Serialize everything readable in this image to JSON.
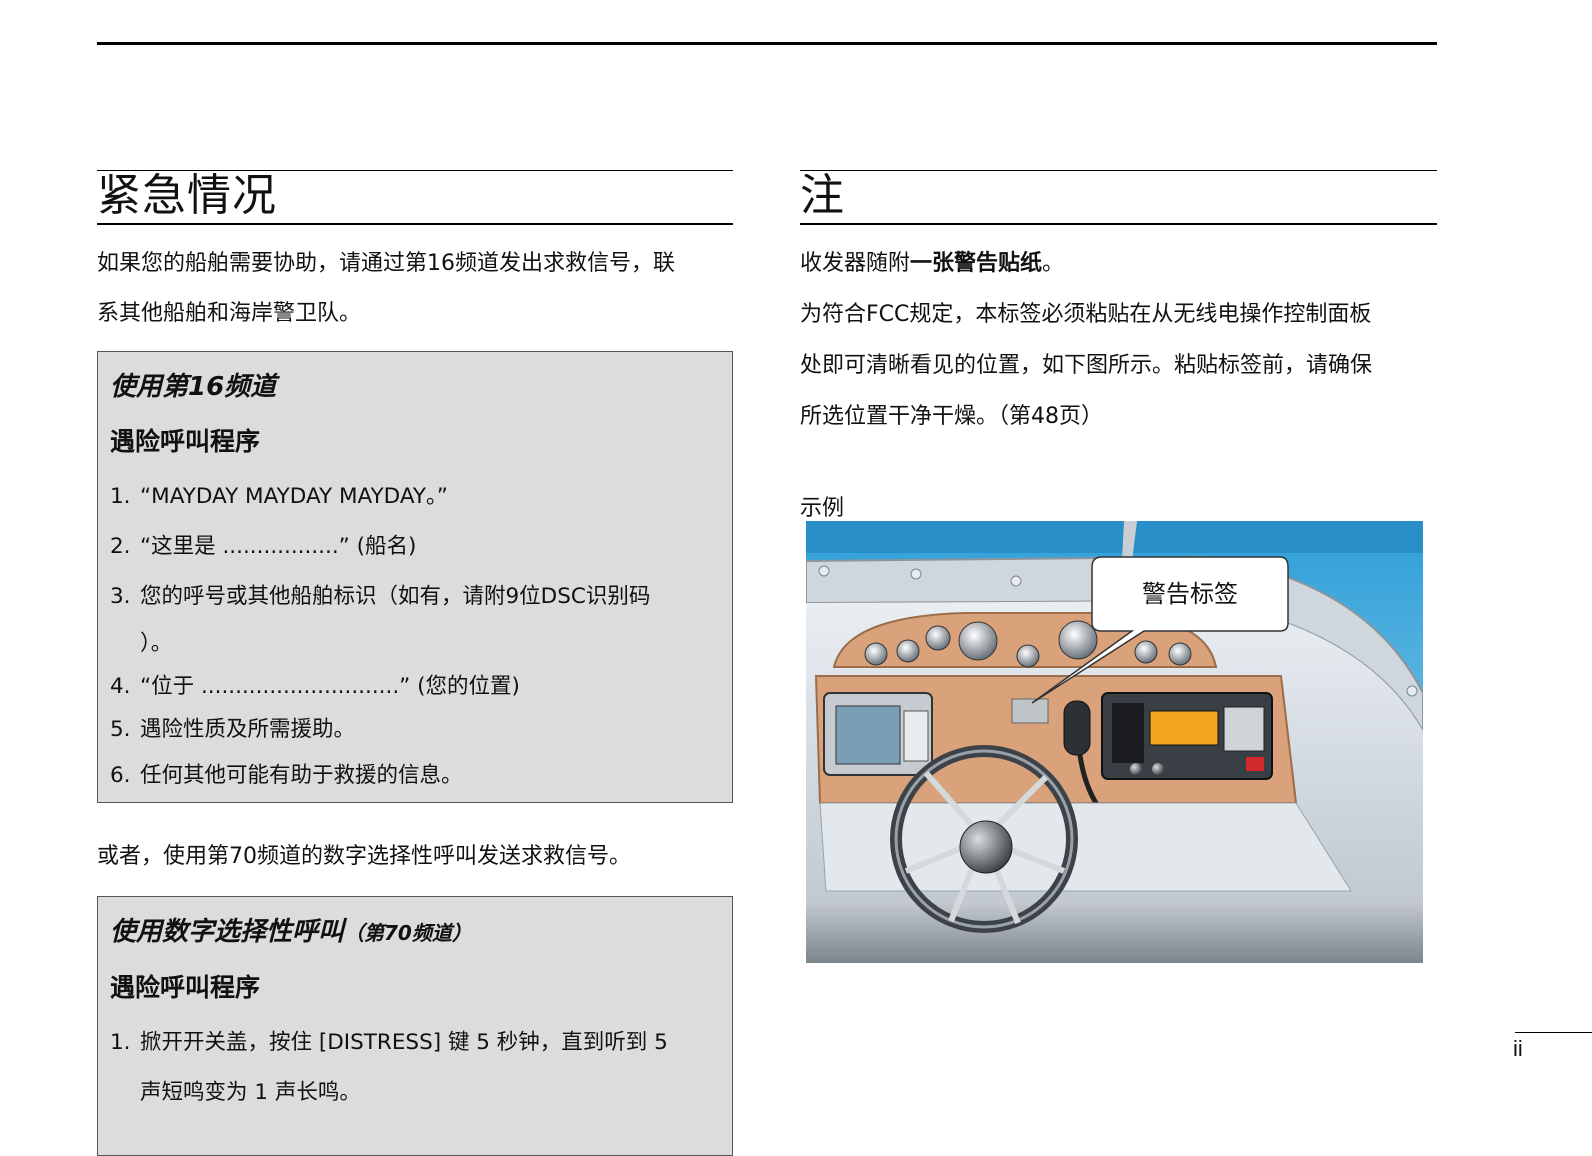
{
  "left": {
    "heading": "紧急情况",
    "intro_line1": "如果您的船舶需要协助，请通过第16频道发出求救信号，联",
    "intro_line2": "系其他船舶和海岸警卫队。",
    "box1": {
      "title": "使用第16频道",
      "subtitle": "遇险呼叫程序",
      "steps": [
        {
          "num": "1.",
          "text": "“MAYDAY MAYDAY MAYDAY。”"
        },
        {
          "num": "2.",
          "text": "“这里是 .................” (船名)"
        },
        {
          "num": "3.",
          "text": "您的呼号或其他船舶标识（如有，请附9位DSC识别码"
        },
        {
          "num": "",
          "text": "）。"
        },
        {
          "num": "4.",
          "text": "“位于 .............................” (您的位置)"
        },
        {
          "num": "5.",
          "text": "遇险性质及所需援助。"
        },
        {
          "num": "6.",
          "text": "任何其他可能有助于救援的信息。"
        }
      ]
    },
    "alt_text": "或者，使用第70频道的数字选择性呼叫发送求救信号。",
    "box2": {
      "title": "使用数字选择性呼叫",
      "title_sub": "（第70频道）",
      "subtitle": "遇险呼叫程序",
      "steps": [
        {
          "num": "1.",
          "text": "掀开开关盖，按住 [DISTRESS] 键 5 秒钟，直到听到 5"
        },
        {
          "num": "",
          "text": "声短鸣变为 1 声长鸣。"
        }
      ]
    }
  },
  "right": {
    "heading": "注",
    "line1_pre": "收发器随附",
    "line1_bold": "一张警告贴纸",
    "line1_post": "。",
    "para_line1": "为符合FCC规定，本标签必须粘贴在从无线电操作控制面板",
    "para_line2": "处即可清晰看见的位置，如下图所示。粘贴标签前，请确保",
    "para_line3": "所选位置干净干燥。（第48页）",
    "example_label": "示例",
    "callout": "警告标签"
  },
  "page_number": "ii",
  "colors": {
    "sky": "#3aa8dc",
    "panel": "#d9a27a",
    "box_bg": "#dcdcdc"
  }
}
